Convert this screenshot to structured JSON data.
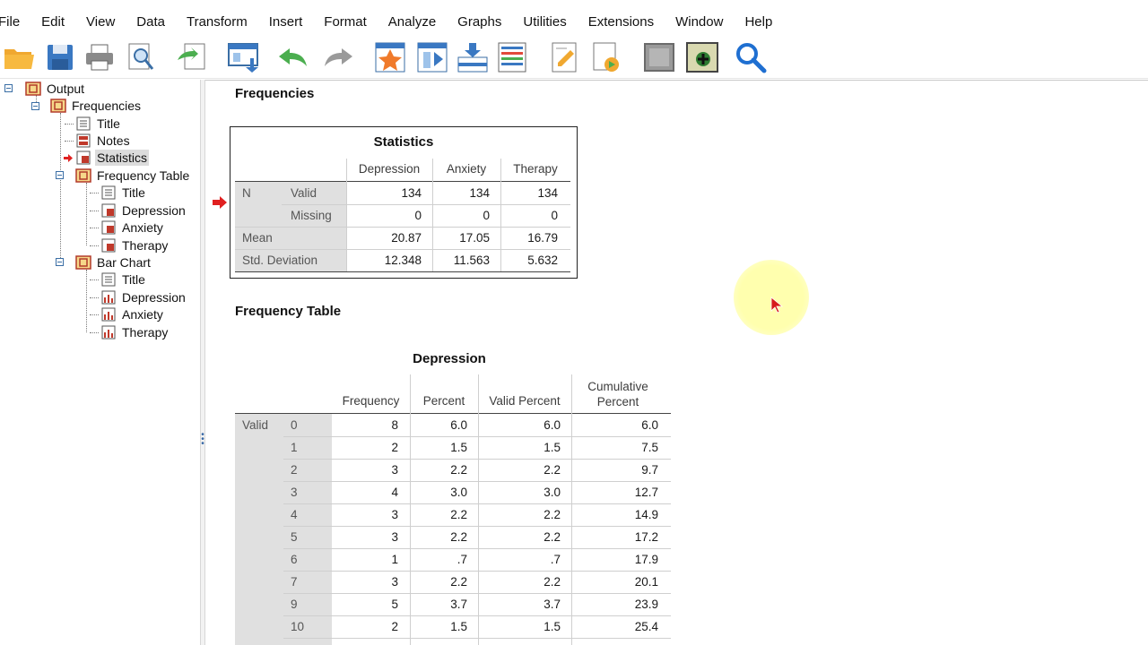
{
  "menu": [
    "File",
    "Edit",
    "View",
    "Data",
    "Transform",
    "Insert",
    "Format",
    "Analyze",
    "Graphs",
    "Utilities",
    "Extensions",
    "Window",
    "Help"
  ],
  "toolbar_icons": [
    "open-folder-icon",
    "save-icon",
    "print-icon",
    "print-preview-icon",
    "export-icon",
    "recall-dialog-icon",
    "undo-icon",
    "redo-icon",
    "goto-case-icon",
    "goto-variable-icon",
    "insert-cases-icon",
    "variables-icon",
    "designate-window-icon",
    "insert-output-icon",
    "hide-icon",
    "show-icon",
    "find-icon"
  ],
  "outline": {
    "items": [
      {
        "label": "Output",
        "level": 0,
        "icon": "output-log-icon"
      },
      {
        "label": "Frequencies",
        "level": 1,
        "icon": "procedure-icon"
      },
      {
        "label": "Title",
        "level": 2,
        "icon": "title-icon"
      },
      {
        "label": "Notes",
        "level": 2,
        "icon": "notes-icon"
      },
      {
        "label": "Statistics",
        "level": 2,
        "icon": "table-icon",
        "selected": true
      },
      {
        "label": "Frequency Table",
        "level": 2,
        "icon": "procedure-icon"
      },
      {
        "label": "Title",
        "level": 3,
        "icon": "title-icon"
      },
      {
        "label": "Depression",
        "level": 3,
        "icon": "table-icon"
      },
      {
        "label": "Anxiety",
        "level": 3,
        "icon": "table-icon"
      },
      {
        "label": "Therapy",
        "level": 3,
        "icon": "table-icon"
      },
      {
        "label": "Bar Chart",
        "level": 2,
        "icon": "procedure-icon"
      },
      {
        "label": "Title",
        "level": 3,
        "icon": "title-icon"
      },
      {
        "label": "Depression",
        "level": 3,
        "icon": "chart-icon"
      },
      {
        "label": "Anxiety",
        "level": 3,
        "icon": "chart-icon"
      },
      {
        "label": "Therapy",
        "level": 3,
        "icon": "chart-icon"
      }
    ]
  },
  "output": {
    "section_title": "Frequencies",
    "stats_table": {
      "title": "Statistics",
      "columns": [
        "Depression",
        "Anxiety",
        "Therapy"
      ],
      "n_label": "N",
      "valid_label": "Valid",
      "missing_label": "Missing",
      "mean_label": "Mean",
      "sd_label": "Std. Deviation",
      "valid": [
        "134",
        "134",
        "134"
      ],
      "missing": [
        "0",
        "0",
        "0"
      ],
      "mean": [
        "20.87",
        "17.05",
        "16.79"
      ],
      "sd": [
        "12.348",
        "11.563",
        "5.632"
      ]
    },
    "freq_section_title": "Frequency Table",
    "freq_table": {
      "title": "Depression",
      "columns": [
        "Frequency",
        "Percent",
        "Valid Percent",
        "Cumulative Percent"
      ],
      "group_label": "Valid",
      "rows": [
        {
          "value": "0",
          "frequency": "8",
          "percent": "6.0",
          "valid_percent": "6.0",
          "cumulative": "6.0"
        },
        {
          "value": "1",
          "frequency": "2",
          "percent": "1.5",
          "valid_percent": "1.5",
          "cumulative": "7.5"
        },
        {
          "value": "2",
          "frequency": "3",
          "percent": "2.2",
          "valid_percent": "2.2",
          "cumulative": "9.7"
        },
        {
          "value": "3",
          "frequency": "4",
          "percent": "3.0",
          "valid_percent": "3.0",
          "cumulative": "12.7"
        },
        {
          "value": "4",
          "frequency": "3",
          "percent": "2.2",
          "valid_percent": "2.2",
          "cumulative": "14.9"
        },
        {
          "value": "5",
          "frequency": "3",
          "percent": "2.2",
          "valid_percent": "2.2",
          "cumulative": "17.2"
        },
        {
          "value": "6",
          "frequency": "1",
          "percent": ".7",
          "valid_percent": ".7",
          "cumulative": "17.9"
        },
        {
          "value": "7",
          "frequency": "3",
          "percent": "2.2",
          "valid_percent": "2.2",
          "cumulative": "20.1"
        },
        {
          "value": "9",
          "frequency": "5",
          "percent": "3.7",
          "valid_percent": "3.7",
          "cumulative": "23.9"
        },
        {
          "value": "10",
          "frequency": "2",
          "percent": "1.5",
          "valid_percent": "1.5",
          "cumulative": "25.4"
        }
      ]
    }
  },
  "colors": {
    "accent_blue": "#3a6ea5",
    "pointer_red": "#e02020",
    "cursor_highlight": "#fffaa0",
    "shade": "#e0e0e0"
  }
}
